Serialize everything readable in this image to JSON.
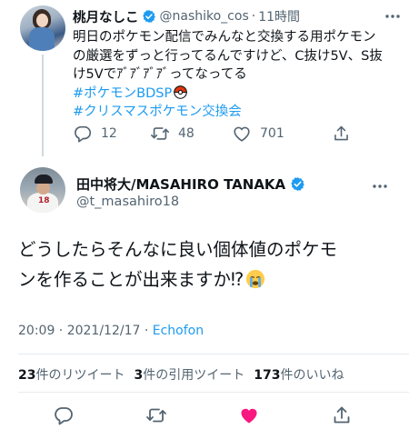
{
  "parent_tweet": {
    "display_name": "桃月なしこ",
    "handle": "@nashiko_cos",
    "separator": "·",
    "time": "11時間",
    "text_lines": [
      "明日のポケモン配信でみんなと交換する用ポケモン",
      "の厳選をずっと行ってるんですけど、C抜け5V、S抜",
      "け5Vでｱﾞｱﾞｱﾞｱﾞってなってる"
    ],
    "hashtags": [
      "#ポケモンBDSP",
      "#クリスマスポケモン交換会"
    ],
    "replies": "12",
    "retweets": "48",
    "likes": "701"
  },
  "focus_tweet": {
    "display_name": "田中将大/MASAHIRO TANAKA",
    "handle": "@t_masahiro18",
    "avatar_number": "18",
    "text_lines": [
      "どうしたらそんなに良い個体値のポケモ",
      "ンを作ることが出来ますか⁉︎"
    ],
    "timestamp": "20:09 · 2021/12/17 · ",
    "source": "Echofon",
    "stats": {
      "retweet_count": "23",
      "retweet_label": "件のリツイート",
      "quote_count": "3",
      "quote_label": "件の引用ツイート",
      "like_count": "173",
      "like_label": "件のいいね"
    }
  },
  "icons": {
    "verified": "verified-badge-icon",
    "reply": "reply-icon",
    "retweet": "retweet-icon",
    "like": "heart-icon",
    "share": "share-icon",
    "more": "more-icon",
    "pokeball": "pokeball-emoji",
    "crying_face": "crying-face-emoji"
  },
  "colors": {
    "accent": "#1d9bf0",
    "muted": "#536471",
    "like_active": "#f91880"
  }
}
